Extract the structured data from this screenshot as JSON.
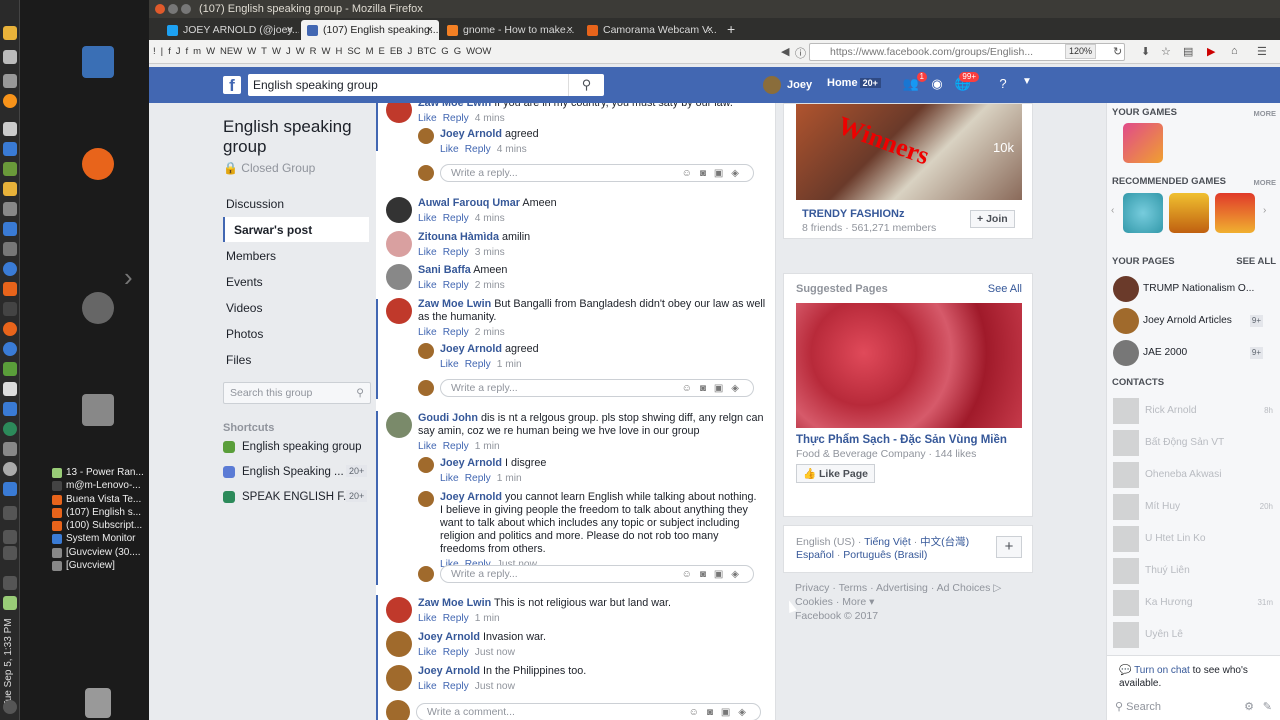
{
  "os": {
    "clock": "Tue Sep 5, 1:33 PM",
    "tasks": [
      {
        "label": "13 - Power Ran...",
        "color": "#9c7"
      },
      {
        "label": "m@m-Lenovo-...",
        "color": "#444"
      },
      {
        "label": "Buena Vista Te...",
        "color": "#e8641b"
      },
      {
        "label": "(107) English s...",
        "color": "#e8641b"
      },
      {
        "label": "(100) Subscript...",
        "color": "#e8641b"
      },
      {
        "label": "System Monitor",
        "color": "#3a7bd5"
      },
      {
        "label": "[Guvcview (30....",
        "color": "#888"
      },
      {
        "label": "[Guvcview]",
        "color": "#888"
      }
    ]
  },
  "window": {
    "title": "(107) English speaking group - Mozilla Firefox"
  },
  "tabs": [
    {
      "label": "JOEY ARNOLD (@joey...",
      "color": "#1da1f2"
    },
    {
      "label": "(107) English speaking...",
      "color": "#4267b2"
    },
    {
      "label": "gnome - How to make...",
      "color": "#f48024"
    },
    {
      "label": "Camorama Webcam V...",
      "color": "#e8641b"
    }
  ],
  "nav": {
    "bookmarks": [
      "!",
      "|",
      "f",
      "J",
      "f",
      "m",
      "W",
      "NEW",
      "W",
      "T",
      "W",
      "J",
      "W",
      "R",
      "W",
      "H",
      "SC",
      "M",
      "E",
      "EB",
      "J",
      "BTC",
      "G",
      "G",
      "WOW"
    ],
    "url": "https://www.facebook.com/groups/English...",
    "zoom": "120%"
  },
  "fb": {
    "search_value": "English speaking group",
    "user": "Joey",
    "home": "Home",
    "home_count": "20+",
    "friend_badge": "1",
    "notif_badge": "99+"
  },
  "group": {
    "title": "English speaking group",
    "privacy": "Closed Group",
    "nav": [
      "Discussion",
      "Sarwar's post",
      "Members",
      "Events",
      "Videos",
      "Photos",
      "Files"
    ],
    "search_placeholder": "Search this group",
    "shortcuts_title": "Shortcuts",
    "shortcuts": [
      {
        "label": "English speaking group",
        "count": "",
        "color": "#5a9e3a"
      },
      {
        "label": "English Speaking ...",
        "count": "20+",
        "color": "#5b7bd5"
      },
      {
        "label": "SPEAK ENGLISH F...",
        "count": "20+",
        "color": "#2c8a5a"
      }
    ]
  },
  "feed": {
    "like": "Like",
    "reply": "Reply",
    "write_reply": "Write a reply...",
    "write_comment": "Write a comment...",
    "comments": [
      {
        "id": "c1",
        "name": "Zaw Moe Lwin",
        "text": "If you are in my country, you must saty by our law.",
        "time": "4 mins",
        "color": "#c0392b"
      },
      {
        "id": "r1",
        "name": "Joey Arnold",
        "text": "agreed",
        "time": "4 mins",
        "color": "#a06a2c"
      },
      {
        "id": "c2",
        "name": "Auwal Farouq Umar",
        "text": "Ameen",
        "time": "4 mins",
        "color": "#333"
      },
      {
        "id": "c3",
        "name": "Zitouna Hàmìda",
        "text": "amilin",
        "time": "3 mins",
        "color": "#d9a0a0"
      },
      {
        "id": "c4",
        "name": "Sani Baffa",
        "text": "Ameen",
        "time": "2 mins",
        "color": "#888"
      },
      {
        "id": "c5",
        "name": "Zaw Moe Lwin",
        "text": "But Bangalli from Bangladesh didn't obey our law as well as the humanity.",
        "time": "2 mins",
        "color": "#c0392b"
      },
      {
        "id": "r2",
        "name": "Joey Arnold",
        "text": "agreed",
        "time": "1 min",
        "color": "#a06a2c"
      },
      {
        "id": "c6",
        "name": "Goudi John",
        "text": "dis is nt a relgous group. pls stop shwing diff, any relgn can say amin, coz we re human being we hve love in our group",
        "time": "1 min",
        "color": "#7a8a6a"
      },
      {
        "id": "r3",
        "name": "Joey Arnold",
        "text": "I disgree",
        "time": "1 min",
        "color": "#a06a2c"
      },
      {
        "id": "r4",
        "name": "Joey Arnold",
        "text": "you cannot learn English while talking about nothing. I believe in giving people the freedom to talk about anything they want to talk about which includes any topic or subject including religion and politics and more. Please do not rob too many freedoms from others.",
        "time": "Just now",
        "color": "#a06a2c"
      },
      {
        "id": "c7",
        "name": "Zaw Moe Lwin",
        "text": "This is not religious war but land war.",
        "time": "1 min",
        "color": "#c0392b"
      },
      {
        "id": "c8",
        "name": "Joey Arnold",
        "text": "Invasion war.",
        "time": "Just now",
        "color": "#a06a2c"
      },
      {
        "id": "c9",
        "name": "Joey Arnold",
        "text": "In the Philippines too.",
        "time": "Just now",
        "color": "#a06a2c"
      }
    ]
  },
  "right": {
    "group_card": {
      "name": "TRENDY FASHIONz",
      "meta": "8 friends · 561,271 members",
      "join": "Join",
      "banner_text": "Winners",
      "badge": "10k"
    },
    "suggested": {
      "title": "Suggested Pages",
      "see_all": "See All",
      "page_name": "Thực Phẩm Sạch - Đặc Sản Vùng Miền",
      "page_meta": "Food & Beverage Company · 144 likes",
      "like_btn": "Like Page"
    },
    "languages": {
      "items": [
        "English (US)",
        "Tiếng Việt",
        "中文(台灣)",
        "Español",
        "Português (Brasil)"
      ]
    },
    "footer": {
      "links": [
        "Privacy",
        "Terms",
        "Advertising",
        "Ad Choices",
        "Cookies",
        "More"
      ],
      "copyright": "Facebook © 2017"
    }
  },
  "chat": {
    "your_games": "YOUR GAMES",
    "more": "MORE",
    "recommended": "RECOMMENDED GAMES",
    "your_pages": "YOUR PAGES",
    "see_all": "SEE ALL",
    "pages": [
      {
        "name": "TRUMP Nationalism O...",
        "count": "",
        "color": "#6a3a2a"
      },
      {
        "name": "Joey Arnold Articles",
        "count": "9+",
        "color": "#a06a2c"
      },
      {
        "name": "JAE 2000",
        "count": "9+",
        "color": "#777"
      }
    ],
    "contacts_title": "CONTACTS",
    "contacts": [
      {
        "name": "Rick Arnold",
        "time": "8h"
      },
      {
        "name": "Bất Động Sản VT",
        "time": ""
      },
      {
        "name": "Oheneba Akwasi",
        "time": ""
      },
      {
        "name": "Mít Huy",
        "time": "20h"
      },
      {
        "name": "U Htet Lin Ko",
        "time": ""
      },
      {
        "name": "Thuý Liên",
        "time": ""
      },
      {
        "name": "Ka Hương",
        "time": "31m"
      },
      {
        "name": "Uyên Lê",
        "time": ""
      }
    ],
    "turn_on": "Turn on chat",
    "turn_on_rest": " to see who's available.",
    "search": "Search"
  }
}
